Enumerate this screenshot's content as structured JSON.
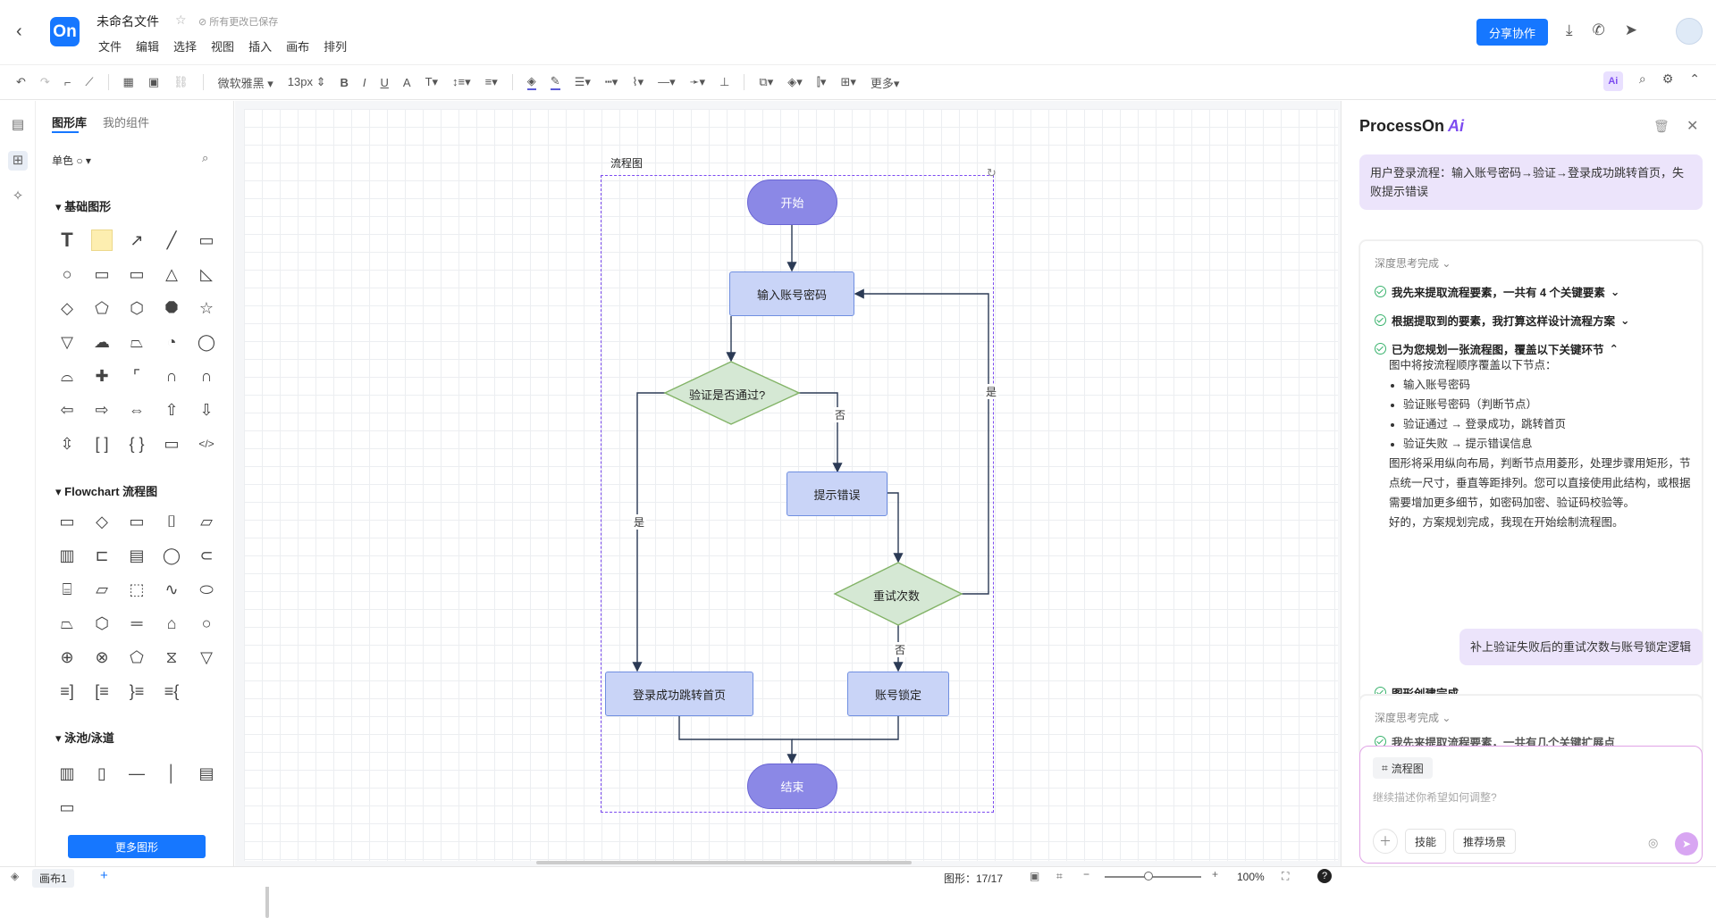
{
  "app": {
    "file_name": "未命名文件",
    "save_status": "所有更改已保存",
    "logo_text": "On",
    "share_label": "分享协作"
  },
  "menu": [
    "文件",
    "编辑",
    "选择",
    "视图",
    "插入",
    "画布",
    "排列"
  ],
  "toolbar": {
    "font": "微软雅黑",
    "font_size": "13px",
    "more": "更多"
  },
  "sidebar": {
    "tabs": [
      "图形库",
      "我的组件"
    ],
    "mode": "单色",
    "sections": {
      "basic": "基础图形",
      "flowchart": "Flowchart 流程图",
      "swimlane": "泳池/泳道"
    },
    "more_button": "更多图形"
  },
  "flow": {
    "group_label": "流程图",
    "start": "开始",
    "input": "输入账号密码",
    "verify": "验证是否通过?",
    "error": "提示错误",
    "retry": "重试次数",
    "home": "登录成功跳转首页",
    "lock": "账号锁定",
    "end": "结束",
    "labels": {
      "no1": "否",
      "yes1": "是",
      "yes2": "是",
      "no2": "否"
    }
  },
  "ai": {
    "brand": "ProcessOn",
    "brand_ai": "Ai",
    "user_msg1": "用户登录流程：输入账号密码→验证→登录成功跳转首页，失败提示错误",
    "think_done": "深度思考完成",
    "steps": [
      "我先来提取流程要素，一共有 4 个关键要素",
      "根据提取到的要素，我打算这样设计流程方案",
      "已为您规划一张流程图，覆盖以下关键环节"
    ],
    "intro": "图中将按流程顺序覆盖以下节点：",
    "bullets": [
      "输入账号密码",
      "验证账号密码（判断节点）",
      "验证通过 → 登录成功，跳转首页",
      "验证失败 → 提示错误信息"
    ],
    "desc": "图形将采用纵向布局，判断节点用菱形，处理步骤用矩形，节点统一尺寸，垂直等距排列。您可以直接使用此结构，或根据需要增加更多细节，如密码加密、验证码校验等。",
    "ready": "好的，方案规划完成，我现在开始绘制流程图。",
    "done": "图形创建完成",
    "user_msg2": "补上验证失败后的重试次数与账号锁定逻辑",
    "think_done2": "深度思考完成",
    "partial": "我先来提取流程要素，一共有几个关键扩展点",
    "chip": "流程图",
    "placeholder": "继续描述你希望如何调整?",
    "btn_skill": "技能",
    "btn_scene": "推荐场景"
  },
  "status": {
    "page": "画布1",
    "shape_count": "图形：17/17",
    "zoom": "100%"
  }
}
